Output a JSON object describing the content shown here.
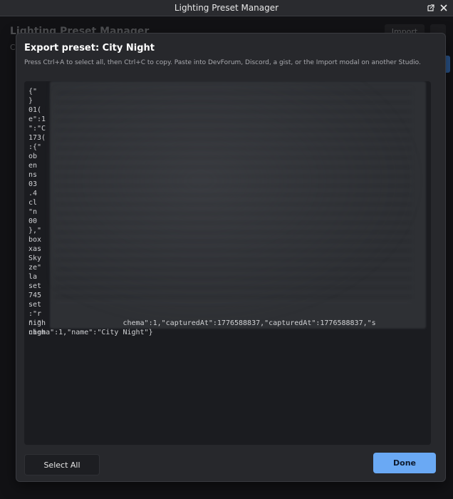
{
  "window": {
    "title": "Lighting Preset Manager",
    "controls": {
      "popout_icon": "popout-icon",
      "close_icon": "close-icon"
    }
  },
  "background": {
    "app_title": "Lighting Preset Manager",
    "import_label": "Import",
    "truncated_subtitle_char": "C"
  },
  "modal": {
    "title": "Export preset: City Night",
    "description": "Press Ctrl+A to select all, then Ctrl+C to copy. Paste into DevForum, Discord, a gist, or the Import modal on another Studio.",
    "json_visible_prefix_lines": [
      "{\"",
      "}",
      "01(",
      "e\":1",
      "\":\"C",
      "173(",
      ":{\"",
      "ob",
      "en",
      "ns",
      "03",
      ".4",
      "cl",
      "\"n",
      "00",
      "},\"",
      "box",
      "xas",
      "Sky",
      "ze\"",
      "la",
      "set",
      "745",
      "set",
      ":\"r",
      "\":\"",
      "nigh"
    ],
    "json_tail_line1": "nigh                  chema\":1,\"capturedAt\":1776588837,\"capturedAt\":1776588837,\"s",
    "json_tail_line2": "chema\":1,\"name\":\"City Night\"}",
    "select_all_label": "Select All",
    "done_label": "Done"
  }
}
